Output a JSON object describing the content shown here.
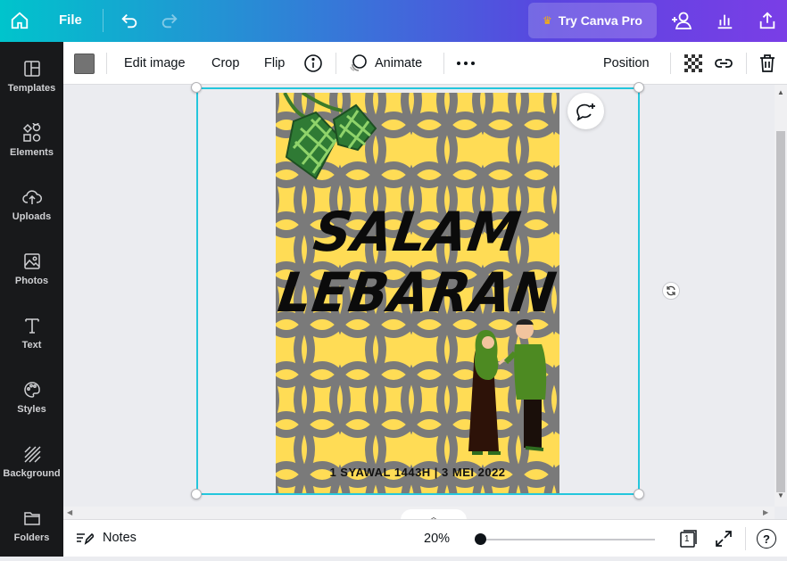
{
  "topbar": {
    "file_label": "File",
    "pro_label": "Try Canva Pro",
    "icons": [
      "home-icon",
      "undo-icon",
      "redo-icon",
      "crown-icon",
      "add-people-icon",
      "chart-icon",
      "share-icon"
    ]
  },
  "sidebar": {
    "items": [
      {
        "label": "Templates",
        "icon": "templates-icon"
      },
      {
        "label": "Elements",
        "icon": "elements-icon"
      },
      {
        "label": "Uploads",
        "icon": "upload-cloud-icon"
      },
      {
        "label": "Photos",
        "icon": "photo-icon"
      },
      {
        "label": "Text",
        "icon": "text-icon"
      },
      {
        "label": "Styles",
        "icon": "palette-icon"
      },
      {
        "label": "Background",
        "icon": "pattern-icon"
      },
      {
        "label": "Folders",
        "icon": "folder-icon"
      }
    ]
  },
  "toolbar": {
    "swatch_color": "#737373",
    "edit_image_label": "Edit image",
    "crop_label": "Crop",
    "flip_label": "Flip",
    "animate_label": "Animate",
    "position_label": "Position"
  },
  "poster": {
    "title_line1": "SALAM",
    "title_line2": "LEBARAN",
    "date_text": "1 SYAWAL 1443H  |  3 MEI 2022",
    "bg_color": "#ffdc55",
    "pattern_color": "#7a7a7a"
  },
  "bottombar": {
    "notes_label": "Notes",
    "zoom_label": "20%",
    "page_count": "1",
    "help_label": "?"
  },
  "colors": {
    "accent": "#24c6dc",
    "sidebar_bg": "#18191b"
  }
}
